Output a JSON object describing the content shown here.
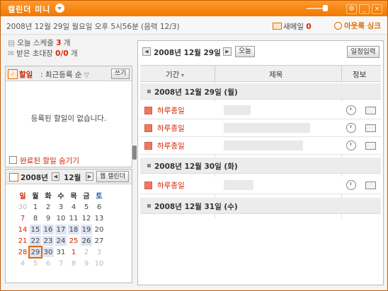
{
  "titlebar": {
    "title": "캘린더 미니",
    "buttons": [
      "⚙",
      "_",
      "×"
    ],
    "accent": "#f07800"
  },
  "topbar": {
    "datetime": "2008년 12월 29일 월요일 오후 5시56분 (음력 12/3)",
    "mail_label": "새메일",
    "mail_count": "0",
    "sync_label": "아웃룩 싱크"
  },
  "summary": {
    "today_label": "오늘 스케줄",
    "today_count": "3",
    "today_unit": "개",
    "invite_label": "받은 초대장",
    "invite_count": "0/0",
    "invite_unit": "개"
  },
  "todo": {
    "title": "할일",
    "sort": ": 최근등록 순",
    "write_button": "쓰기",
    "empty_text": "등록된 할일이 없습니다.",
    "hide_done_label": "완료된 할일 숨기기"
  },
  "mini_calendar": {
    "year": "2008년",
    "month": "12월",
    "prev": "◀",
    "next": "▶",
    "web_button": "웹 캘린더",
    "weekdays": [
      "일",
      "월",
      "화",
      "수",
      "목",
      "금",
      "토"
    ],
    "weeks": [
      [
        "30",
        "1",
        "2",
        "3",
        "4",
        "5",
        "6"
      ],
      [
        "7",
        "8",
        "9",
        "10",
        "11",
        "12",
        "13"
      ],
      [
        "14",
        "15",
        "16",
        "17",
        "18",
        "19",
        "20"
      ],
      [
        "21",
        "22",
        "23",
        "24",
        "25",
        "26",
        "27"
      ],
      [
        "28",
        "29",
        "30",
        "31",
        "1",
        "2",
        "3"
      ],
      [
        "4",
        "5",
        "6",
        "7",
        "8",
        "9",
        "10"
      ]
    ],
    "today": "29"
  },
  "schedule": {
    "current_date": "2008년 12월 29일",
    "prev": "◀",
    "next": "▶",
    "today_button": "오늘",
    "add_button": "일정입력",
    "columns": [
      "기간",
      "제목",
      "정보"
    ],
    "days": [
      {
        "label": "2008년 12월 29일 (월)",
        "items": [
          "하루종일",
          "하루종일",
          "하루종일"
        ]
      },
      {
        "label": "2008년 12월 30일 (화)",
        "items": [
          "하루종일"
        ]
      },
      {
        "label": "2008년 12월 31일 (수)",
        "items": []
      }
    ]
  }
}
